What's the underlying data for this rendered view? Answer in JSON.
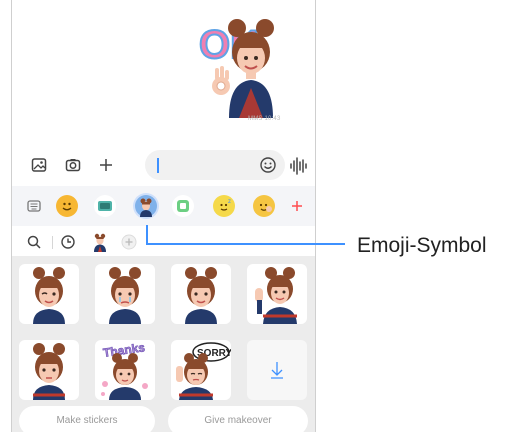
{
  "chat": {
    "sticker_text": "OK",
    "timestamp": "MMS 10:43"
  },
  "composer": {
    "message_value": "",
    "icons": [
      "gallery-icon",
      "camera-icon",
      "plus-icon",
      "emoji-icon",
      "voice-icon"
    ]
  },
  "categories": [
    {
      "name": "keyboard-tab",
      "color": "#d9dbe2"
    },
    {
      "name": "emoji-tab",
      "color": "#f7b733"
    },
    {
      "name": "gif-tab",
      "color": "#4fb3a9"
    },
    {
      "name": "ar-emoji-tab",
      "color": "#7fb1ea",
      "selected": true
    },
    {
      "name": "sticker-tab",
      "color": "#6ccf83"
    },
    {
      "name": "bitmoji-tab",
      "color": "#f5d94a"
    },
    {
      "name": "emoji-kitchen-tab",
      "color": "#f5c542"
    },
    {
      "name": "add-tab",
      "color": "#ff4d4f"
    }
  ],
  "sub_tabs": [
    "search-icon",
    "recent-icon",
    "ar-emoji-sticker-icon",
    "add-sticker-icon"
  ],
  "stickers": [
    {
      "name": "wink-sticker",
      "text": ""
    },
    {
      "name": "cry-sticker",
      "text": ""
    },
    {
      "name": "smile-sticker",
      "text": ""
    },
    {
      "name": "wave-sticker",
      "text": ""
    },
    {
      "name": "neutral-sticker",
      "text": ""
    },
    {
      "name": "thanks-sticker",
      "text": "Thanks"
    },
    {
      "name": "sorry-sticker",
      "text": "SORRY"
    },
    {
      "name": "download-sticker",
      "text": ""
    }
  ],
  "buttons": {
    "make_stickers": "Make stickers",
    "give_makeover": "Give makeover"
  },
  "annotation": {
    "label": "Emoji-Symbol"
  },
  "colors": {
    "accent": "#3e91ff",
    "hair": "#8a4a2c",
    "skin": "#f6c9b2",
    "shirt": "#243a6b",
    "ok_pink": "#f07fb1",
    "ok_blue": "#5fa3e6"
  }
}
